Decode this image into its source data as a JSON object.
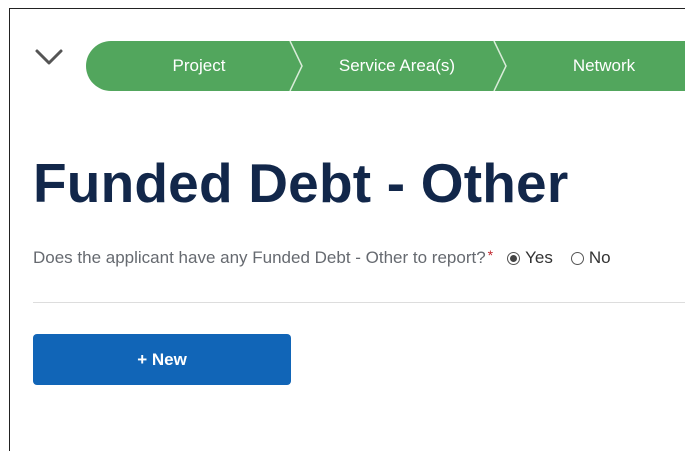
{
  "stepper": {
    "steps": [
      {
        "label": "Project"
      },
      {
        "label": "Service Area(s)"
      },
      {
        "label": "Network"
      }
    ],
    "color": "#52a65d"
  },
  "page": {
    "title": "Funded Debt - Other"
  },
  "question": {
    "text": "Does the applicant have any Funded Debt - Other to report?",
    "required_marker": "*",
    "options": [
      {
        "label": "Yes",
        "selected": true
      },
      {
        "label": "No",
        "selected": false
      }
    ]
  },
  "actions": {
    "new_label": "+ New"
  },
  "icons": {
    "collapse": "chevron-down-icon"
  },
  "colors": {
    "title": "#12274a",
    "button": "#1165b7",
    "required": "#c0262d"
  }
}
